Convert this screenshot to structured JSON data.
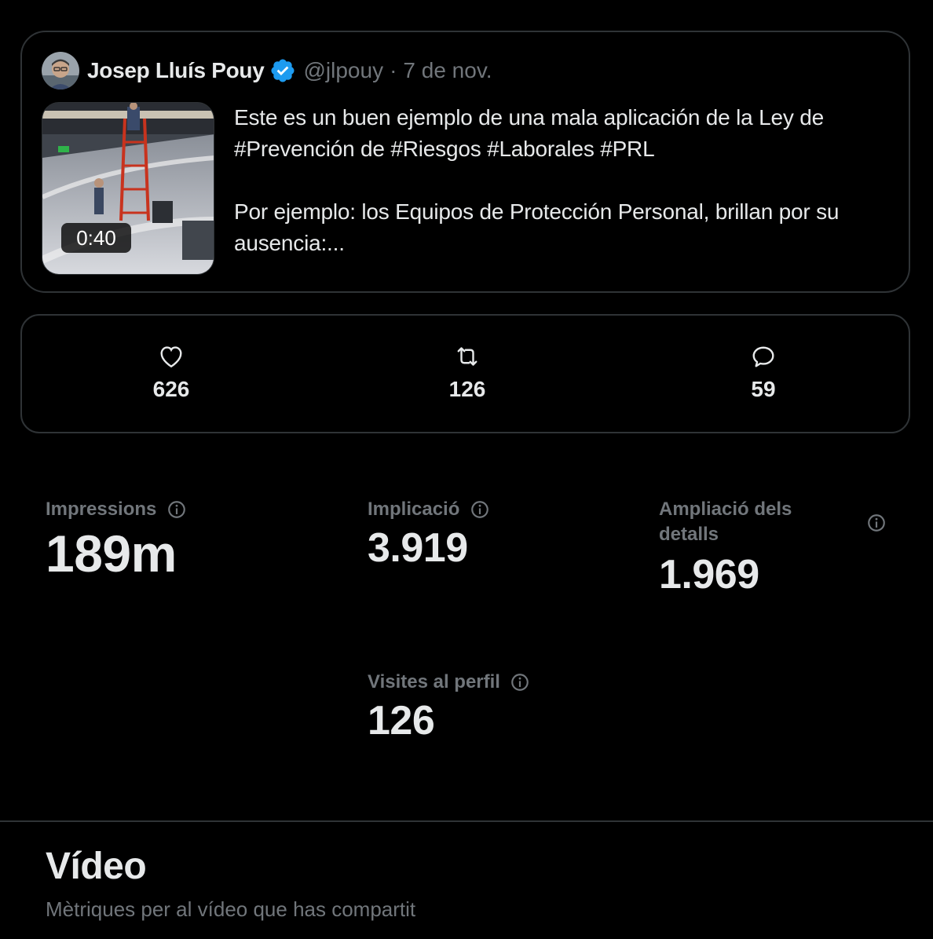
{
  "tweet": {
    "author_name": "Josep Lluís Pouy",
    "verified": true,
    "handle": "@jlpouy",
    "separator": "·",
    "date": "7 de nov.",
    "video_duration": "0:40",
    "text": "Este es un buen ejemplo de una mala aplicación de la Ley de #Prevención de #Riesgos #Laborales #PRL\n\nPor ejemplo: los Equipos de Protección Personal, brillan por su ausencia:..."
  },
  "engagement": {
    "likes": {
      "icon": "heart-icon",
      "count": "626"
    },
    "reposts": {
      "icon": "repost-icon",
      "count": "126"
    },
    "replies": {
      "icon": "reply-icon",
      "count": "59"
    }
  },
  "metrics": {
    "impressions": {
      "label": "Impressions",
      "value": "189m"
    },
    "engagement": {
      "label": "Implicació",
      "value": "3.919"
    },
    "detail_expands": {
      "label": "Ampliació dels detalls",
      "value": "1.969"
    },
    "profile_visits": {
      "label": "Visites al perfil",
      "value": "126"
    }
  },
  "video_section": {
    "title": "Vídeo",
    "subtitle": "Mètriques per al vídeo que has compartit"
  },
  "colors": {
    "background": "#000000",
    "text_primary": "#e7e9ea",
    "text_secondary": "#71767b",
    "border": "#2f3336",
    "verified_blue": "#1d9bf0"
  }
}
